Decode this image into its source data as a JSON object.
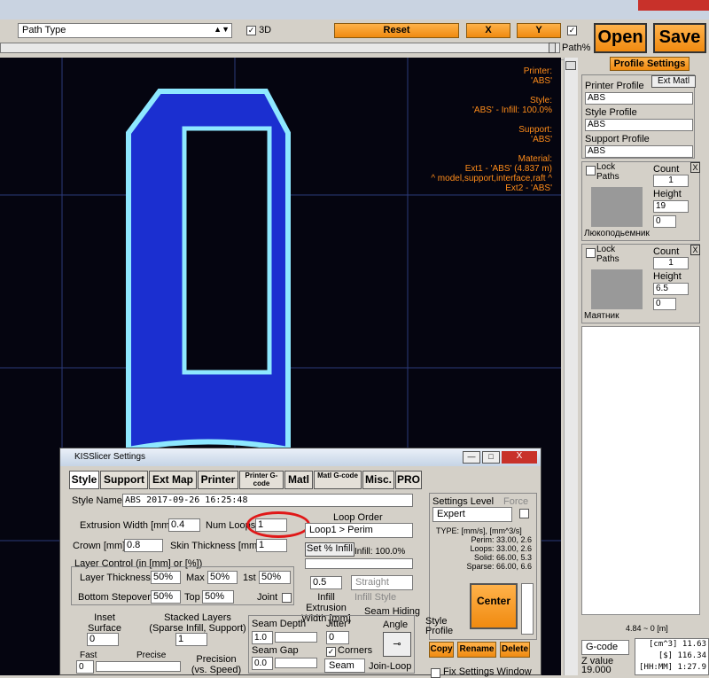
{
  "toolbar": {
    "view_select": "Path Type",
    "check_3d": "3D",
    "reset_label": "Reset",
    "x_label": "X",
    "y_label": "Y",
    "path_pct": "Path%",
    "open_label": "Open",
    "save_label": "Save"
  },
  "overlay": {
    "printer_label": "Printer:",
    "printer_value": "'ABS'",
    "style_label": "Style:",
    "style_value": "'ABS' - Infill: 100.0%",
    "support_label": "Support:",
    "support_value": "'ABS'",
    "material_label": "Material:",
    "ext1": "Ext1 - 'ABS' (4.837 m)",
    "ext1_sub": "^ model,support,interface,raft ^",
    "ext2": "Ext2 - 'ABS'"
  },
  "right_panel": {
    "profile_settings": "Profile Settings",
    "ext_matl": "Ext Matl",
    "printer_profile_label": "Printer Profile",
    "printer_profile": "ABS",
    "style_profile_label": "Style Profile",
    "style_profile": "ABS",
    "support_profile_label": "Support Profile",
    "support_profile": "ABS",
    "obj1": {
      "lock": "Lock Paths",
      "count_label": "Count",
      "count": "1",
      "height_label": "Height",
      "height": "19",
      "rot": "0",
      "name": "Люкоподьемник",
      "close": "X"
    },
    "obj2": {
      "lock": "Lock Paths",
      "count_label": "Count",
      "count": "1",
      "height_label": "Height",
      "height": "6.5",
      "rot": "0",
      "name": "Маятник",
      "close": "X"
    },
    "range": "4.84 ~ 0 [m]",
    "gcode_sel": "G-code",
    "z_value_label": "Z value",
    "z_value": "19.000",
    "stat1": "[cm^3] 11.63",
    "stat2": "[$] 116.34",
    "stat3": "[HH:MM] 1:27.9"
  },
  "dialog": {
    "title": "KISSlicer Settings",
    "tabs": [
      "Style",
      "Support",
      "Ext Map",
      "Printer",
      "Printer G-code",
      "Matl",
      "Matl G-code",
      "Misc.",
      "PRO"
    ],
    "style_name_label": "Style Name",
    "style_name": "ABS  2017-09-26 16:25:48",
    "extrusion_width_label": "Extrusion Width [mm]",
    "extrusion_width": "0.4",
    "num_loops_label": "Num Loops",
    "num_loops": "1",
    "crown_label": "Crown [mm]",
    "crown": "0.8",
    "skin_thickness_label": "Skin Thickness [mm]",
    "skin_thickness": "1",
    "loop_order_label": "Loop Order",
    "loop_order": "Loop1 > Perim",
    "set_infill": "Set % Infill",
    "infill_pct": "Infill: 100.0%",
    "infill_width": "0.5",
    "infill_style": "Straight",
    "infill_style_label": "Infill Style",
    "infill_extrusion_label": "Infill Extrusion Width [mm]",
    "layer_control_label": "Layer Control (in [mm] or [%])",
    "layer_thickness_label": "Layer Thickness",
    "layer_thickness": "50%",
    "max_label": "Max",
    "max": "50%",
    "first_label": "1st",
    "first": "50%",
    "bottom_stepover_label": "Bottom Stepover",
    "bottom_stepover": "50%",
    "top_label": "Top",
    "top": "50%",
    "joint_label": "Joint",
    "inset_label": "Inset Surface [mm]",
    "inset": "0",
    "stacked_label": "Stacked Layers (Sparse Infill, Support)",
    "stacked": "1",
    "fast_label": "Fast",
    "precise_label": "Precise",
    "precision_value": "0",
    "precision_label": "Precision (vs. Speed)",
    "seam_depth_label": "Seam Depth",
    "seam_depth": "1.0",
    "jitter_label": "Jitter°",
    "jitter": "0",
    "seam_hiding_label": "Seam Hiding",
    "angle_label": "Angle",
    "seam_gap_label": "Seam Gap",
    "seam_gap": "0.0",
    "corners_label": "Corners",
    "seam_sel": "Seam",
    "join_loop_label": "Join-Loop",
    "settings_level_label": "Settings Level",
    "force_label": "Force",
    "settings_level": "Expert",
    "type_label": "TYPE: [mm/s], [mm^3/s]",
    "perim": "Perim:  33.00,  2.6",
    "loops": "Loops:  33.00,  2.6",
    "solid": "Solid:  66.00,  5.3",
    "sparse": "Sparse:  66.00,  6.6",
    "center_label": "Center",
    "style_profile_label": "Style Profile",
    "copy_label": "Copy",
    "rename_label": "Rename",
    "delete_label": "Delete",
    "fix_settings_label": "Fix Settings Window"
  }
}
